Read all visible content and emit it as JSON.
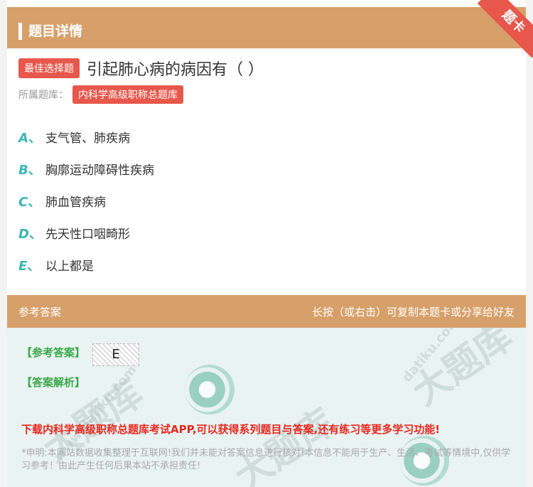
{
  "header": {
    "title": "题目详情",
    "ribbon": "题卡"
  },
  "question": {
    "tag": "最佳选择题",
    "text": "引起肺心病的病因有（ ）",
    "library_label": "所属题库：",
    "library_name": "内科学高级职称总题库"
  },
  "options": [
    {
      "letter": "A",
      "sep": "、",
      "text": "支气管、肺疾病"
    },
    {
      "letter": "B",
      "sep": "、",
      "text": "胸廓运动障碍性疾病"
    },
    {
      "letter": "C",
      "sep": "、",
      "text": "肺血管疾病"
    },
    {
      "letter": "D",
      "sep": "、",
      "text": "先天性口咽畸形"
    },
    {
      "letter": "E",
      "sep": "、",
      "text": "以上都是"
    }
  ],
  "answer_section": {
    "title": "参考答案",
    "hint": "长按（或右击）可复制本题卡或分享给好友",
    "ref_answer_label": "【参考答案】",
    "ref_answer_value": "E",
    "analysis_label": "【答案解析】",
    "promo": "下载内科学高级职称总题库考试APP,可以获得系列题目与答案,还有练习等更多学习功能!",
    "disclaimer": "*申明:本网站数据收集整理于互联网!我们并未能对答案信息进行核对!本信息不能用于生产、生活、考试等情境中,仅供学习参考！由此产生任何后果本站不承担责任!"
  },
  "colors": {
    "accent": "#d7a06a",
    "tag_red": "#e8574b",
    "option_letter": "#3cb5b5",
    "answer_green": "#3aa84a",
    "promo_red": "#e8271e"
  }
}
